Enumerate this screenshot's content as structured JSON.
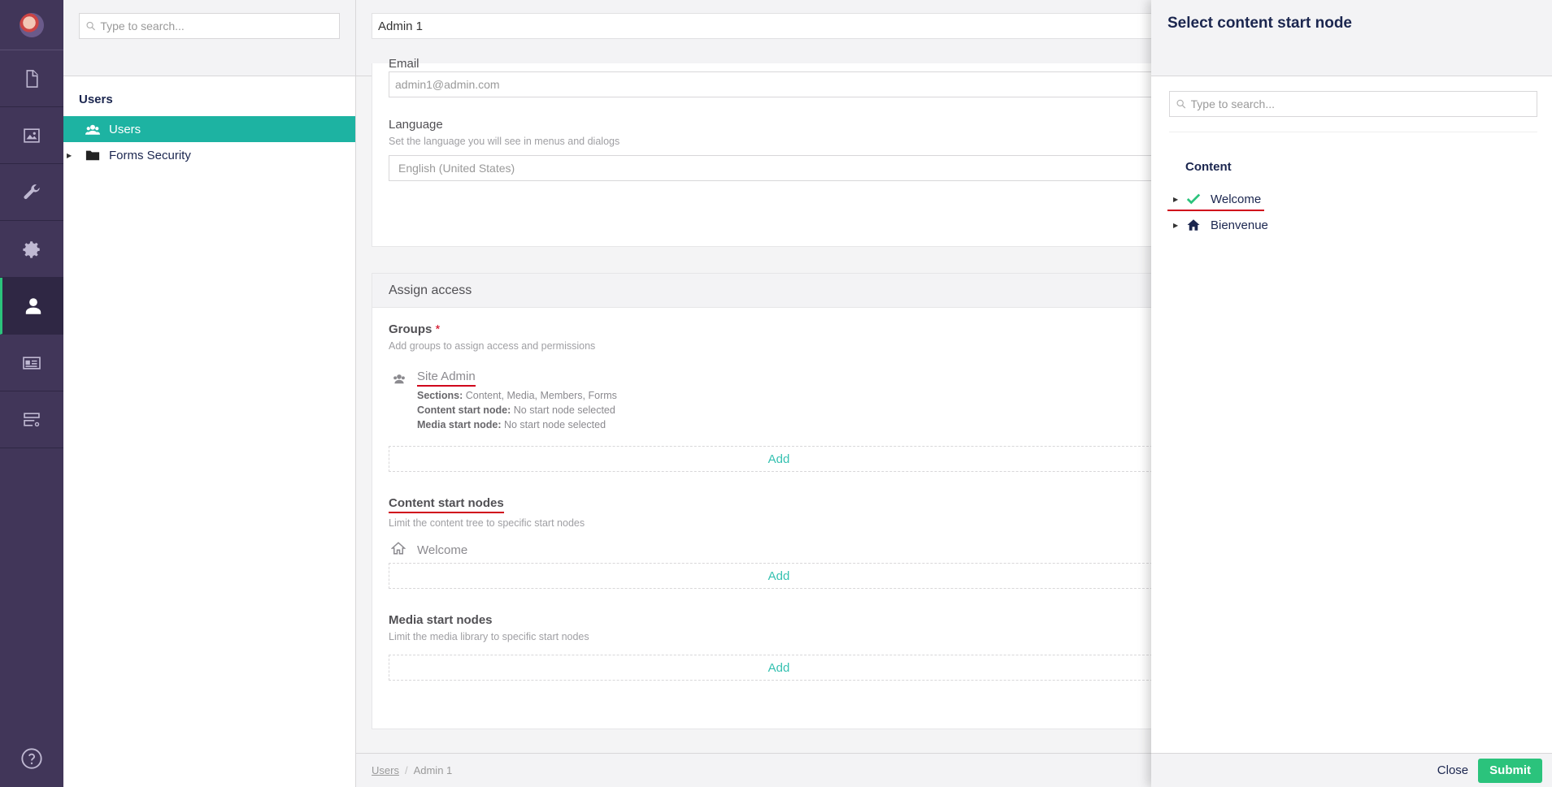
{
  "sidebar": {
    "items": [
      {
        "icon": "document-icon",
        "active": false
      },
      {
        "icon": "image-icon",
        "active": false
      },
      {
        "icon": "wrench-icon",
        "active": false
      },
      {
        "icon": "gear-icon",
        "active": false
      },
      {
        "icon": "user-icon",
        "active": true
      },
      {
        "icon": "member-card-icon",
        "active": false
      },
      {
        "icon": "forms-icon",
        "active": false
      }
    ],
    "help_icon": "help-icon"
  },
  "tree": {
    "search_placeholder": "Type to search...",
    "title": "Users",
    "items": [
      {
        "label": "Users",
        "icon": "users-icon",
        "selected": true
      },
      {
        "label": "Forms Security",
        "icon": "folder-icon",
        "selected": false
      }
    ]
  },
  "editor": {
    "name": "Admin 1",
    "email_label": "Email",
    "email_value": "admin1@admin.com",
    "language_label": "Language",
    "language_desc": "Set the language you will see in menus and dialogs",
    "language_value": "English (United States)",
    "assign_access": "Assign access",
    "groups_label": "Groups",
    "groups_required": "*",
    "groups_desc": "Add groups to assign access and permissions",
    "group": {
      "name": "Site Admin",
      "sections_label": "Sections:",
      "sections_value": "Content, Media, Members, Forms",
      "content_start_label": "Content start node:",
      "content_start_value": "No start node selected",
      "media_start_label": "Media start node:",
      "media_start_value": "No start node selected"
    },
    "add_label": "Add",
    "content_start_nodes_label": "Content start nodes",
    "content_start_nodes_desc": "Limit the content tree to specific start nodes",
    "content_start_node": "Welcome",
    "media_start_nodes_label": "Media start nodes",
    "media_start_nodes_desc": "Limit the media library to specific start nodes"
  },
  "breadcrumb": {
    "root": "Users",
    "separator": "/",
    "current": "Admin 1"
  },
  "overlay": {
    "title": "Select content start node",
    "search_placeholder": "Type to search...",
    "section": "Content",
    "nodes": [
      {
        "label": "Welcome",
        "icon": "check-icon",
        "selected": true
      },
      {
        "label": "Bienvenue",
        "icon": "home-icon",
        "selected": false
      }
    ],
    "close_label": "Close",
    "submit_label": "Submit"
  },
  "colors": {
    "sidebar_bg": "#413659",
    "tree_selected": "#1db3a2",
    "submit": "#2bc37c",
    "add_link": "#35c1b1",
    "highlight": "#d0021b"
  }
}
